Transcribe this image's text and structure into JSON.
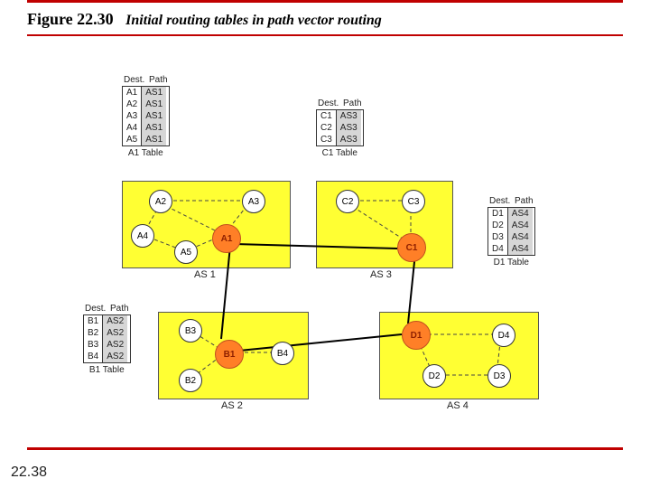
{
  "figure": {
    "number": "Figure 22.30",
    "caption": "Initial routing tables in path vector routing"
  },
  "page_number": "22.38",
  "as": {
    "as1": {
      "label": "AS 1",
      "nodes": {
        "a1": "A1",
        "a2": "A2",
        "a3": "A3",
        "a4": "A4",
        "a5": "A5"
      }
    },
    "as2": {
      "label": "AS 2",
      "nodes": {
        "b1": "B1",
        "b2": "B2",
        "b3": "B3",
        "b4": "B4"
      }
    },
    "as3": {
      "label": "AS 3",
      "nodes": {
        "c1": "C1",
        "c2": "C2",
        "c3": "C3"
      }
    },
    "as4": {
      "label": "AS 4",
      "nodes": {
        "d1": "D1",
        "d2": "D2",
        "d3": "D3",
        "d4": "D4"
      }
    }
  },
  "tables": {
    "a1": {
      "hdr_dest": "Dest.",
      "hdr_path": "Path",
      "rows": [
        {
          "d": "A1",
          "p": "AS1"
        },
        {
          "d": "A2",
          "p": "AS1"
        },
        {
          "d": "A3",
          "p": "AS1"
        },
        {
          "d": "A4",
          "p": "AS1"
        },
        {
          "d": "A5",
          "p": "AS1"
        }
      ],
      "caption": "A1 Table"
    },
    "c1": {
      "hdr_dest": "Dest.",
      "hdr_path": "Path",
      "rows": [
        {
          "d": "C1",
          "p": "AS3"
        },
        {
          "d": "C2",
          "p": "AS3"
        },
        {
          "d": "C3",
          "p": "AS3"
        }
      ],
      "caption": "C1 Table"
    },
    "d1": {
      "hdr_dest": "Dest.",
      "hdr_path": "Path",
      "rows": [
        {
          "d": "D1",
          "p": "AS4"
        },
        {
          "d": "D2",
          "p": "AS4"
        },
        {
          "d": "D3",
          "p": "AS4"
        },
        {
          "d": "D4",
          "p": "AS4"
        }
      ],
      "caption": "D1 Table"
    },
    "b1": {
      "hdr_dest": "Dest.",
      "hdr_path": "Path",
      "rows": [
        {
          "d": "B1",
          "p": "AS2"
        },
        {
          "d": "B2",
          "p": "AS2"
        },
        {
          "d": "B3",
          "p": "AS2"
        },
        {
          "d": "B4",
          "p": "AS2"
        }
      ],
      "caption": "B1 Table"
    }
  }
}
